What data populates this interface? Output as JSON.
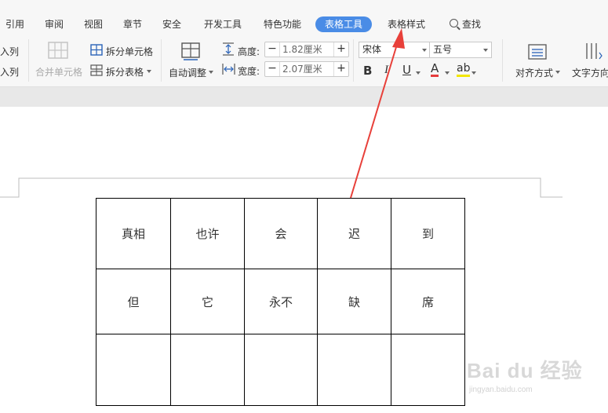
{
  "menu": {
    "tabs": [
      "引用",
      "审阅",
      "视图",
      "章节",
      "安全",
      "开发工具",
      "特色功能",
      "表格工具",
      "表格样式"
    ],
    "active_tab": "表格工具",
    "search_label": "查找"
  },
  "ribbon": {
    "insert_col_top": "入列",
    "insert_col_bottom": "入列",
    "merge_cells": "合并单元格",
    "split_cells": "拆分单元格",
    "split_table": "拆分表格",
    "auto_adjust": "自动调整",
    "height_label": "高度:",
    "height_value": "1.82厘米",
    "width_label": "宽度:",
    "width_value": "2.07厘米",
    "font_name": "宋体",
    "font_size": "五号",
    "bold": "B",
    "italic": "I",
    "underline": "U",
    "font_color": "A",
    "highlight": "ab",
    "align": "对齐方式",
    "text_direction": "文字方向"
  },
  "table": {
    "rows": [
      [
        "真相",
        "也许",
        "会",
        "迟",
        "到"
      ],
      [
        "但",
        "它",
        "永不",
        "缺",
        "席"
      ],
      [
        "",
        "",
        "",
        "",
        ""
      ]
    ]
  },
  "watermark": {
    "text": "Bai du 经验",
    "url": "jingyan.baidu.com"
  },
  "colors": {
    "accent": "#4a8ce6",
    "arrow": "#e8403a"
  }
}
